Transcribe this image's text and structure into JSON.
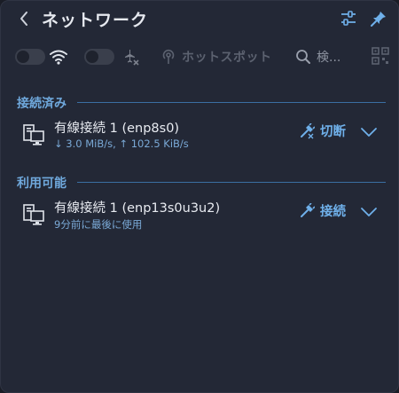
{
  "header": {
    "title": "ネットワーク"
  },
  "controls": {
    "wifi_toggle_on": false,
    "airplane_toggle_on": false,
    "hotspot_label": "ホットスポット",
    "search_label": "検..."
  },
  "sections": {
    "connected": {
      "title": "接続済み",
      "item": {
        "name": "有線接続 1 (enp8s0)",
        "speed": "↓ 3.0 MiB/s, ↑ 102.5 KiB/s",
        "action_label": "切断"
      }
    },
    "available": {
      "title": "利用可能",
      "item": {
        "name": "有線接続 1 (enp13s0u3u2)",
        "last_used": "9分前に最後に使用",
        "action_label": "接続"
      }
    }
  },
  "colors": {
    "accent": "#6fb0ea",
    "section_title": "#6fa8dc",
    "background": "#232836"
  }
}
